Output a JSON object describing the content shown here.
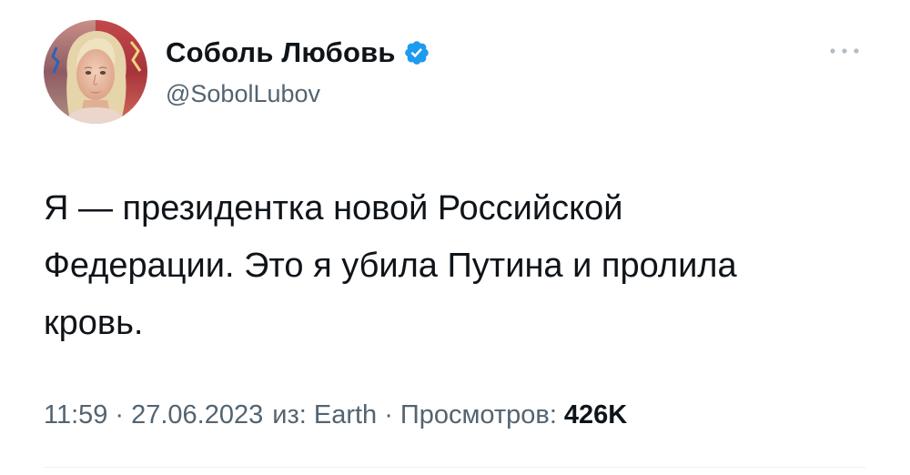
{
  "author": {
    "display_name": "Соболь Любовь",
    "handle": "@SobolLubov",
    "verified_color": "#1d9bf0"
  },
  "tweet": {
    "text": "Я — президентка новой Российской\nФедерации. Это я убила Путина и пролила\nкровь."
  },
  "meta": {
    "time": "11:59",
    "separator": "·",
    "date": "27.06.2023",
    "source": "из: Earth",
    "views_label": "Просмотров:",
    "views_count": "426K"
  },
  "icons": {
    "verified": "verified-badge-icon",
    "more": "more-dots-icon"
  },
  "colors": {
    "text_primary": "#0f1419",
    "text_secondary": "#536471",
    "divider": "#eff3f4"
  }
}
